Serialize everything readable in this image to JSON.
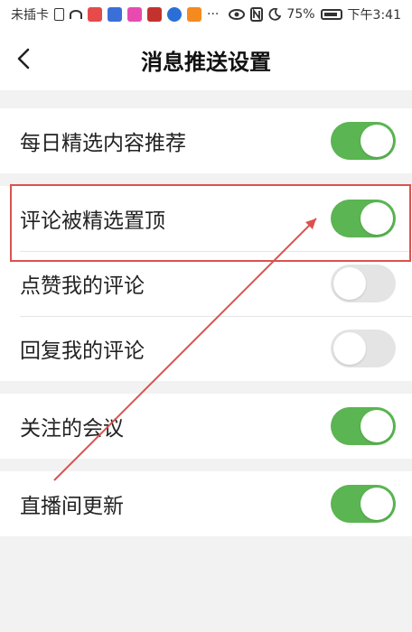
{
  "status_bar": {
    "carrier": "未插卡",
    "more": "···",
    "battery": "75%",
    "time": "下午3:41"
  },
  "header": {
    "title": "消息推送设置",
    "back_icon": "chevron-left-icon"
  },
  "settings": {
    "daily_picks": {
      "label": "每日精选内容推荐",
      "enabled": true
    },
    "comment_pinned": {
      "label": "评论被精选置顶",
      "enabled": true
    },
    "likes_my_comment": {
      "label": "点赞我的评论",
      "enabled": false
    },
    "replies_my_comment": {
      "label": "回复我的评论",
      "enabled": false
    },
    "followed_meetings": {
      "label": "关注的会议",
      "enabled": true
    },
    "live_room_updates": {
      "label": "直播间更新",
      "enabled": true
    }
  },
  "colors": {
    "toggle_on": "#5ab552",
    "toggle_off": "#e4e4e4",
    "annotation": "#d9534f"
  }
}
